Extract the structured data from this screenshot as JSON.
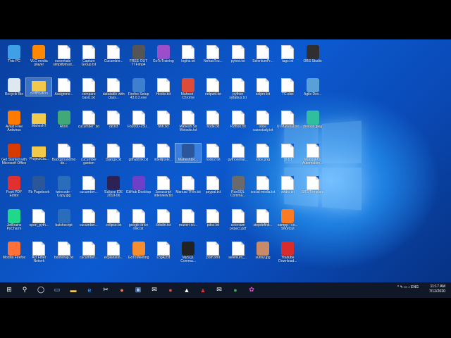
{
  "desktop": {
    "columns": [
      [
        {
          "label": "This PC",
          "icon": "this-pc-icon",
          "kind": "app",
          "color": "#3fa0e8"
        },
        {
          "label": "Recycle Bin",
          "icon": "recycle-bin-icon",
          "kind": "app",
          "color": "#dfe7f0"
        },
        {
          "label": "Avast Free Antivirus",
          "icon": "avast-icon",
          "kind": "app",
          "color": "#ff7a00"
        },
        {
          "label": "Get Started with Microsoft Office",
          "icon": "office-icon",
          "kind": "app",
          "color": "#d83b01"
        },
        {
          "label": "Foxit PDF Editor",
          "icon": "foxit-pdf-icon",
          "kind": "app",
          "color": "#e03030"
        },
        {
          "label": "JetBrains PyCharm",
          "icon": "pycharm-icon",
          "kind": "app",
          "color": "#21d789"
        },
        {
          "label": "Mozilla Firefox",
          "icon": "firefox-icon",
          "kind": "app",
          "color": "#ff7139"
        }
      ],
      [
        {
          "label": "VLC media player",
          "icon": "vlc-icon",
          "kind": "app",
          "color": "#ff8800"
        },
        {
          "label": "certification",
          "icon": "folder-icon",
          "kind": "folder",
          "selected": true
        },
        {
          "label": "MaheshT",
          "icon": "folder-icon",
          "kind": "folder"
        },
        {
          "label": "ProjectCla...",
          "icon": "folder-icon",
          "kind": "folder"
        },
        {
          "label": "Fb Pagebook",
          "icon": "word-icon",
          "kind": "app",
          "color": "#2b579a"
        },
        {
          "label": "open_pyth...",
          "icon": "file-icon",
          "kind": "file"
        },
        {
          "label": "Act Fiber Netwrk",
          "icon": "file-icon",
          "kind": "file"
        }
      ],
      [
        {
          "label": "essentials - simplifytrust...",
          "icon": "file-icon",
          "kind": "file"
        },
        {
          "label": "Assignme...",
          "icon": "file-icon",
          "kind": "file"
        },
        {
          "label": "Atom",
          "icon": "atom-icon",
          "kind": "app",
          "color": "#40a977"
        },
        {
          "label": "Backgroundmode...",
          "icon": "file-icon",
          "kind": "file"
        },
        {
          "label": "twincode - Copy.jpg",
          "icon": "nx-icon",
          "kind": "app",
          "color": "#2a6ebb"
        },
        {
          "label": "batchscript",
          "icon": "nx-icon",
          "kind": "app",
          "color": "#2a6ebb"
        },
        {
          "label": "bootstrap.txt",
          "icon": "file-icon",
          "kind": "file"
        }
      ],
      [
        {
          "label": "Capture Group.txt",
          "icon": "file-icon",
          "kind": "file"
        },
        {
          "label": "compare basic.txt",
          "icon": "file-icon",
          "kind": "file"
        },
        {
          "label": "cucumber .txt",
          "icon": "file-icon",
          "kind": "file"
        },
        {
          "label": "cucumber garden",
          "icon": "file-icon",
          "kind": "file"
        },
        {
          "label": "cucumber...",
          "icon": "file-icon",
          "kind": "file"
        },
        {
          "label": "cucumber...",
          "icon": "file-icon",
          "kind": "file"
        },
        {
          "label": "cucumber...",
          "icon": "file-icon",
          "kind": "file"
        }
      ],
      [
        {
          "label": "Cucumber...",
          "icon": "file-icon",
          "kind": "file"
        },
        {
          "label": "datatable with class...",
          "icon": "file-icon",
          "kind": "file"
        },
        {
          "label": "dd.txt",
          "icon": "file-icon",
          "kind": "file"
        },
        {
          "label": "Django.txt",
          "icon": "file-icon",
          "kind": "file"
        },
        {
          "label": "Eclipse IDE 2019-06",
          "icon": "eclipse-icon",
          "kind": "app",
          "color": "#2c2255"
        },
        {
          "label": "eclipse.txt",
          "icon": "file-icon",
          "kind": "file"
        },
        {
          "label": "explanatio...",
          "icon": "file-icon",
          "kind": "file"
        }
      ],
      [
        {
          "label": "FREE OUT TTFimp4",
          "icon": "video-icon",
          "kind": "app",
          "color": "#555555"
        },
        {
          "label": "Firefox Setup 43.0.2.exe",
          "icon": "firefox-setup-icon",
          "kind": "app",
          "color": "#3f7fd0"
        },
        {
          "label": "Fb2000-250...",
          "icon": "file-icon",
          "kind": "file"
        },
        {
          "label": "githublink.txt",
          "icon": "file-icon",
          "kind": "file"
        },
        {
          "label": "GitHub Desktop",
          "icon": "github-desktop-icon",
          "kind": "app",
          "color": "#6e40c9"
        },
        {
          "label": "google drive link.txt",
          "icon": "file-icon",
          "kind": "file"
        },
        {
          "label": "GoToMeeting",
          "icon": "gotomeeting-icon",
          "kind": "app",
          "color": "#f68d2e"
        }
      ],
      [
        {
          "label": "GoToTraining",
          "icon": "gototraining-icon",
          "kind": "app",
          "color": "#9b4dca"
        },
        {
          "label": "Hooks.txt",
          "icon": "file-icon",
          "kind": "file"
        },
        {
          "label": "hhh.txt",
          "icon": "settings-file-icon",
          "kind": "file"
        },
        {
          "label": "intellijnote...",
          "icon": "file-icon",
          "kind": "file"
        },
        {
          "label": "Javascript interview.txt",
          "icon": "file-icon",
          "kind": "file"
        },
        {
          "label": "linkdin.txt",
          "icon": "settings-file-icon",
          "kind": "file"
        },
        {
          "label": "Log4j.txt",
          "icon": "settings-file-icon",
          "kind": "file"
        }
      ],
      [
        {
          "label": "logins.txt",
          "icon": "image-file-icon",
          "kind": "file"
        },
        {
          "label": "Mahesh - Chrome",
          "icon": "chrome-icon",
          "kind": "app",
          "color": "#dd4b39"
        },
        {
          "label": "Mahesh Sir Website.txt",
          "icon": "settings-file-icon",
          "kind": "file"
        },
        {
          "label": "MaheshDo...",
          "icon": "word-icon",
          "kind": "app",
          "color": "#2b579a",
          "selected": true
        },
        {
          "label": "Manual TFile.txt",
          "icon": "file-icon",
          "kind": "file"
        },
        {
          "label": "maven-co...",
          "icon": "file-icon",
          "kind": "file"
        },
        {
          "label": "MySQL Comma...",
          "icon": "mysql-cmd-icon",
          "kind": "app",
          "color": "#222222"
        }
      ],
      [
        {
          "label": "NehasTou...",
          "icon": "file-icon",
          "kind": "file"
        },
        {
          "label": "netpwd.txt",
          "icon": "file-icon",
          "kind": "file"
        },
        {
          "label": "node.txt",
          "icon": "file-icon",
          "kind": "file"
        },
        {
          "label": "node2.txt",
          "icon": "settings-file-icon",
          "kind": "file"
        },
        {
          "label": "paypal.txt",
          "icon": "file-icon",
          "kind": "file"
        },
        {
          "label": "pdsc.txt",
          "icon": "file-icon",
          "kind": "file"
        },
        {
          "label": "pom.xml",
          "icon": "xml-file-icon",
          "kind": "file"
        }
      ],
      [
        {
          "label": "pytest.txt",
          "icon": "file-icon",
          "kind": "file"
        },
        {
          "label": "python syllabus.txt",
          "icon": "file-icon",
          "kind": "file"
        },
        {
          "label": "Python.txt",
          "icon": "file-icon",
          "kind": "file"
        },
        {
          "label": "pythonintal...",
          "icon": "file-icon",
          "kind": "file"
        },
        {
          "label": "RunSQL Comma...",
          "icon": "sql-icon",
          "kind": "app",
          "color": "#6a6a6a"
        },
        {
          "label": "selenium project.pdf",
          "icon": "pdf-file-icon",
          "kind": "file"
        },
        {
          "label": "selenium_...",
          "icon": "file-icon",
          "kind": "file"
        }
      ],
      [
        {
          "label": "SeleniumPr...",
          "icon": "file-icon",
          "kind": "file"
        },
        {
          "label": "selpro.txt",
          "icon": "file-icon",
          "kind": "file"
        },
        {
          "label": "slice casestudy.txt",
          "icon": "file-icon",
          "kind": "file"
        },
        {
          "label": "slice.png",
          "icon": "file-icon",
          "kind": "file"
        },
        {
          "label": "social media.txt",
          "icon": "file-icon",
          "kind": "file"
        },
        {
          "label": "stepdefinit...",
          "icon": "file-icon",
          "kind": "file"
        },
        {
          "label": "sunny.jpg",
          "icon": "photo-icon",
          "kind": "app",
          "color": "#c98a6a"
        }
      ],
      [
        {
          "label": "tags.txt",
          "icon": "file-icon",
          "kind": "file"
        },
        {
          "label": "TC.xlsx",
          "icon": "excel-file-icon",
          "kind": "file"
        },
        {
          "label": "UI Material.txt",
          "icon": "file-icon",
          "kind": "file"
        },
        {
          "label": "UI.txt",
          "icon": "file-icon",
          "kind": "file"
        },
        {
          "label": "wildio.txt",
          "icon": "file-icon",
          "kind": "file"
        },
        {
          "label": "xampp - co... Shortcut",
          "icon": "xampp-icon",
          "kind": "app",
          "color": "#fb7a24"
        },
        {
          "label": "Youtube Download...",
          "icon": "youtube-downloader-icon",
          "kind": "app",
          "color": "#d82b2b"
        }
      ],
      [
        {
          "label": "OBS Studio",
          "icon": "obs-icon",
          "kind": "app",
          "color": "#302e31"
        },
        {
          "label": "Agile Dev...",
          "icon": "agile-icon",
          "kind": "app",
          "color": "#5aa0d8"
        },
        {
          "label": "devops.jpeg",
          "icon": "devops-icon",
          "kind": "app",
          "color": "#2fbf9f"
        },
        {
          "label": "Manual Vs Automation...",
          "icon": "file-icon",
          "kind": "file"
        },
        {
          "label": "SRS Template",
          "icon": "file-icon",
          "kind": "file"
        }
      ]
    ]
  },
  "taskbar": {
    "start": "⊞",
    "items": [
      {
        "name": "search-icon",
        "glyph": "⚲",
        "color": "#ffffff"
      },
      {
        "name": "task-view-icon",
        "glyph": "◯",
        "color": "#ffffff"
      },
      {
        "name": "taskbar-app-icon",
        "glyph": "▭",
        "color": "#9ac4ff"
      },
      {
        "name": "file-explorer-icon",
        "glyph": "▬",
        "color": "#f3c94c"
      },
      {
        "name": "edge-icon",
        "glyph": "e",
        "color": "#3aa0ff"
      },
      {
        "name": "snipping-tool-icon",
        "glyph": "✂",
        "color": "#ffffff"
      },
      {
        "name": "firefox-icon",
        "glyph": "●",
        "color": "#ff7139"
      },
      {
        "name": "windows-store-icon",
        "glyph": "▣",
        "color": "#9ac4ff"
      },
      {
        "name": "mail-icon",
        "glyph": "✉",
        "color": "#ffffff"
      },
      {
        "name": "chrome-icon",
        "glyph": "●",
        "color": "#dd4b39"
      },
      {
        "name": "photos-icon",
        "glyph": "▲",
        "color": "#ffffff"
      },
      {
        "name": "acrobat-icon",
        "glyph": "▲",
        "color": "#e03030"
      },
      {
        "name": "mail-app-icon",
        "glyph": "✉",
        "color": "#ffffff"
      },
      {
        "name": "chrome-profile-icon",
        "glyph": "●",
        "color": "#35a853"
      },
      {
        "name": "gototraining-icon",
        "glyph": "✿",
        "color": "#e04bc9"
      }
    ],
    "tray": "^ ✎ ▭ ♪ ENG",
    "time": "11:17 AM",
    "date": "7/12/2020"
  }
}
